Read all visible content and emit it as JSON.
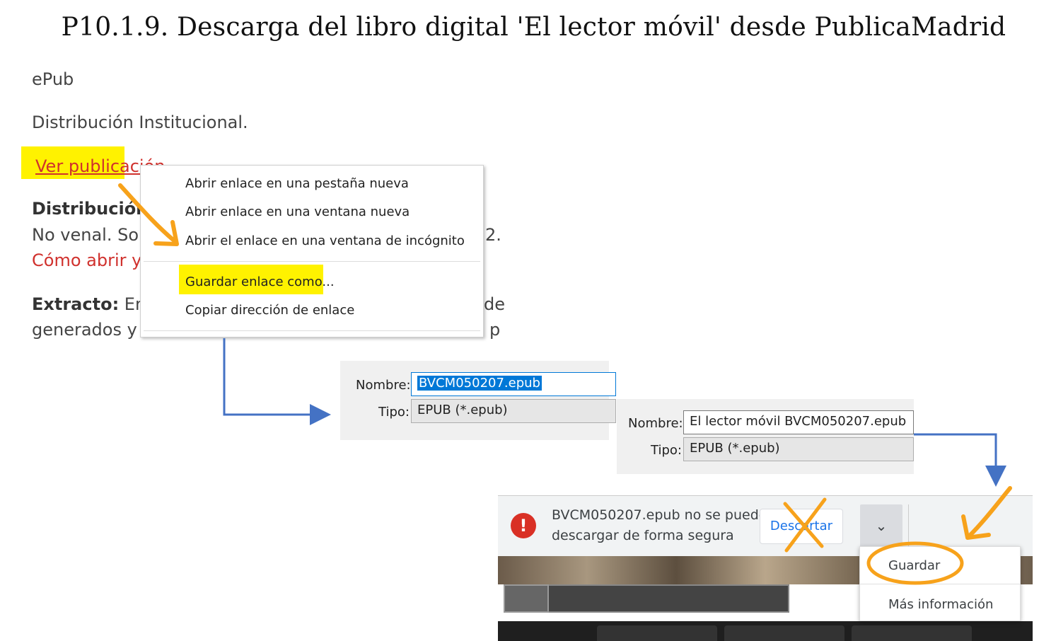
{
  "title": "P10.1.9. Descarga del libro digital 'El lector móvil' desde PublicaMadrid",
  "page": {
    "format": "ePub",
    "distribution_type": "Distribución Institucional.",
    "view_link": "Ver publicación",
    "distribution_label": "Distribución:",
    "distribution_value": "No venal. So",
    "distribution_trail": "2.",
    "how_to_open": "Cómo abrir y",
    "extract_label": "Extracto:",
    "extract_value": " Ens",
    "extract_trail": "de",
    "extract_line2": "generados y",
    "extract_line2_trail": "p"
  },
  "context_menu": {
    "items": [
      "Abrir enlace en una pestaña nueva",
      "Abrir enlace en una ventana nueva",
      "Abrir el enlace en una ventana de incógnito",
      "Guardar enlace como...",
      "Copiar dirección de enlace"
    ]
  },
  "save_dialog_1": {
    "name_label": "Nombre:",
    "name_value": "BVCM050207.epub",
    "type_label": "Tipo:",
    "type_value": "EPUB (*.epub)"
  },
  "save_dialog_2": {
    "name_label": "Nombre:",
    "name_value": "El lector móvil BVCM050207.epub",
    "type_label": "Tipo:",
    "type_value": "EPUB (*.epub)"
  },
  "download_bar": {
    "warning_icon": "exclamation-icon",
    "message_line1": "BVCM050207.epub no se puede",
    "message_line2": "descargar de forma segura",
    "discard_label": "Descartar",
    "chevron_icon": "chevron-down-icon",
    "menu_items": [
      "Guardar",
      "Más información"
    ]
  },
  "colors": {
    "highlight": "#fff200",
    "link_red": "#d0312d",
    "annotation_orange": "#f7a21b",
    "arrow_blue": "#4472c4"
  }
}
